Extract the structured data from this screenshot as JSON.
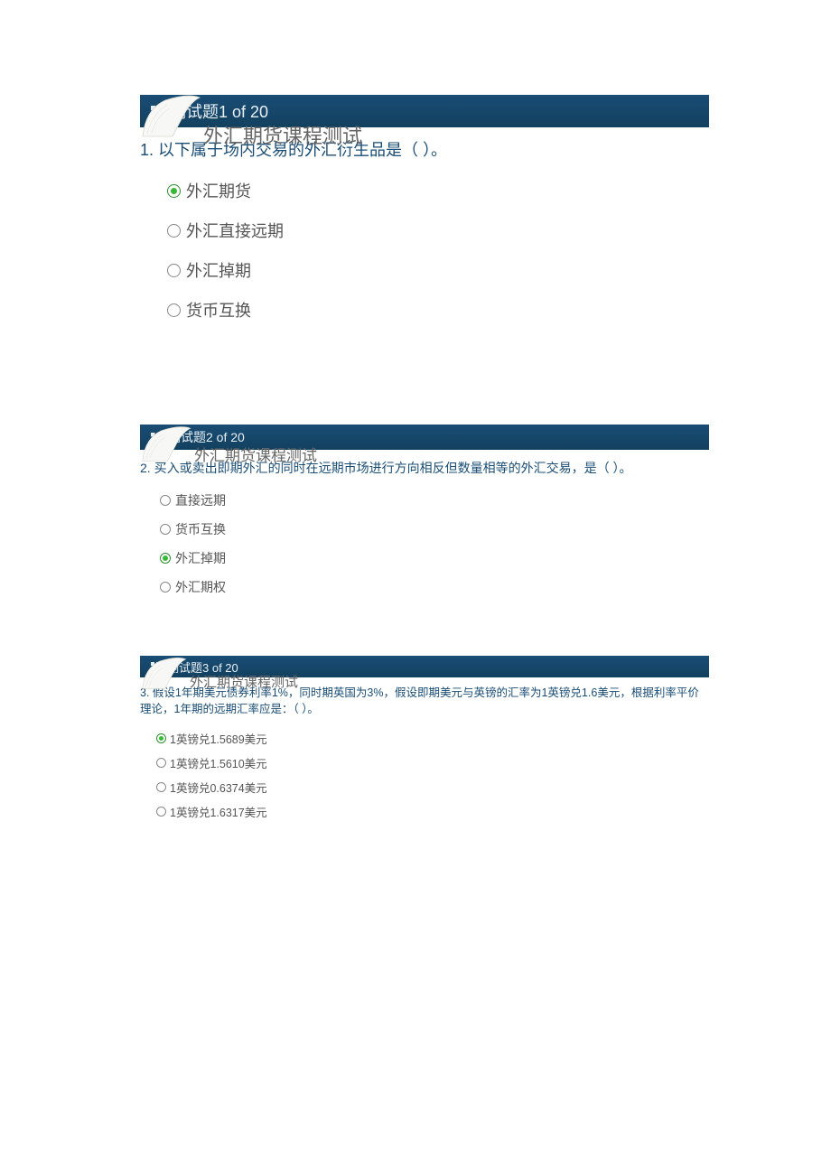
{
  "course_title": "外汇期货课程测试",
  "questions": [
    {
      "header": "测试题1 of 20",
      "prompt": "1. 以下属于场内交易的外汇衍生品是（ ）。",
      "options": [
        "外汇期货",
        "外汇直接远期",
        "外汇掉期",
        "货币互换"
      ],
      "selected": 0
    },
    {
      "header": "测试题2 of 20",
      "prompt": "2. 买入或卖出即期外汇的同时在远期市场进行方向相反但数量相等的外汇交易，是（ ）。",
      "options": [
        "直接远期",
        "货币互换",
        "外汇掉期",
        "外汇期权"
      ],
      "selected": 2
    },
    {
      "header": "测试题3 of 20",
      "prompt": "3. 假设1年期美元债券利率1%，同时期英国为3%，假设即期美元与英镑的汇率为1英镑兑1.6美元，根据利率平价理论，1年期的远期汇率应是：（ ）。",
      "options": [
        "1英镑兑1.5689美元",
        "1英镑兑1.5610美元",
        "1英镑兑0.6374美元",
        "1英镑兑1.6317美元"
      ],
      "selected": 0
    }
  ]
}
